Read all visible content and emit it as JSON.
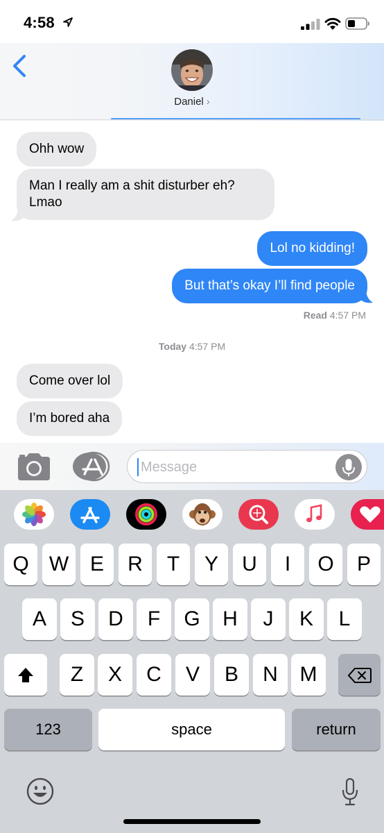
{
  "status_bar": {
    "time": "4:58"
  },
  "header": {
    "contact_name": "Daniel",
    "name_chevron": "›"
  },
  "messages": [
    {
      "direction": "incoming",
      "text": "Ohh wow"
    },
    {
      "direction": "incoming",
      "text": "Man I really am a shit disturber eh? Lmao"
    },
    {
      "direction": "outgoing",
      "text": "Lol no kidding!"
    },
    {
      "direction": "outgoing",
      "text": "But that’s okay I’ll find people"
    },
    {
      "direction": "incoming",
      "text": "Come over lol"
    },
    {
      "direction": "incoming",
      "text": "I’m bored aha"
    }
  ],
  "read_receipt": {
    "label": "Read",
    "time": "4:57 PM"
  },
  "timestamp": {
    "label": "Today",
    "time": "4:57 PM"
  },
  "composer": {
    "placeholder": "Message"
  },
  "app_drawer": [
    "photos-app",
    "app-store-app",
    "activity-app",
    "animoji-app",
    "image-search-app",
    "music-app",
    "digital-touch-app"
  ],
  "keyboard": {
    "row1": [
      "Q",
      "W",
      "E",
      "R",
      "T",
      "Y",
      "U",
      "I",
      "O",
      "P"
    ],
    "row2": [
      "A",
      "S",
      "D",
      "F",
      "G",
      "H",
      "J",
      "K",
      "L"
    ],
    "row3": [
      "Z",
      "X",
      "C",
      "V",
      "B",
      "N",
      "M"
    ],
    "numbers_label": "123",
    "space_label": "space",
    "return_label": "return"
  },
  "colors": {
    "accent": "#2f86f6",
    "incoming_bubble": "#e9e9eb",
    "keyboard_bg": "#d1d4d9"
  }
}
